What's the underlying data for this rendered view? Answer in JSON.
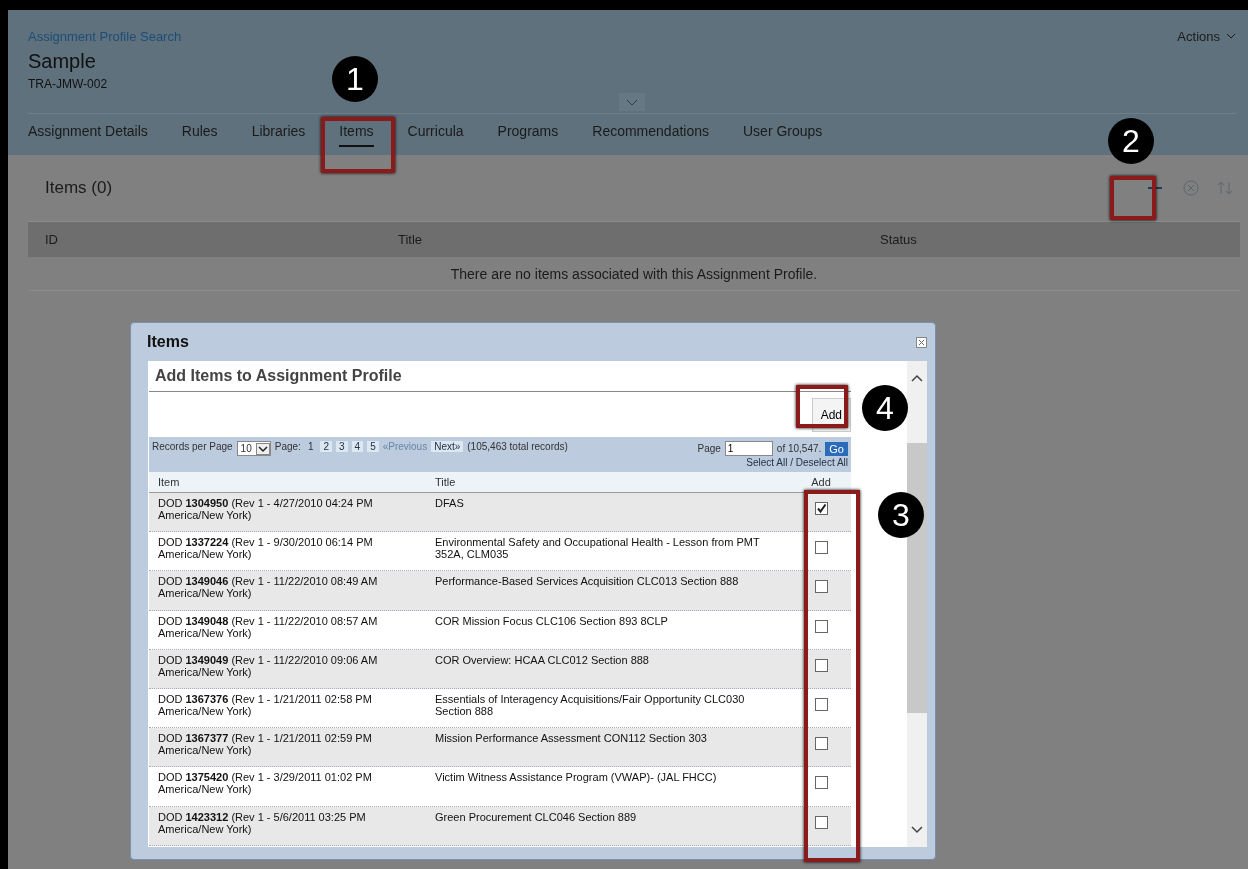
{
  "header": {
    "breadcrumb": "Assignment Profile Search",
    "title": "Sample",
    "code": "TRA-JMW-002",
    "actions": "Actions"
  },
  "tabs": [
    {
      "label": "Assignment Details",
      "selected": false
    },
    {
      "label": "Rules",
      "selected": false
    },
    {
      "label": "Libraries",
      "selected": false
    },
    {
      "label": "Items",
      "selected": true
    },
    {
      "label": "Curricula",
      "selected": false
    },
    {
      "label": "Programs",
      "selected": false
    },
    {
      "label": "Recommendations",
      "selected": false
    },
    {
      "label": "User Groups",
      "selected": false
    }
  ],
  "section": {
    "title": "Items (0)",
    "columns": [
      "ID",
      "Title",
      "Status"
    ],
    "empty_message": "There are no items associated with this Assignment Profile."
  },
  "dialog": {
    "title": "Items",
    "heading": "Add Items to Assignment Profile",
    "add_button": {
      "label": "Add"
    },
    "pager": {
      "records_label": "Records per Page",
      "per_page": "10",
      "page_label": "Page:",
      "pages": [
        {
          "label": "1",
          "selected": true
        },
        {
          "label": "2",
          "selected": false
        },
        {
          "label": "3",
          "selected": false
        },
        {
          "label": "4",
          "selected": false
        },
        {
          "label": "5",
          "selected": false
        }
      ],
      "previous": "«Previous",
      "next": "Next»",
      "total": "(105,463 total records)",
      "goto_label": "Page",
      "goto_value": "1",
      "of": "of 10,547.",
      "go": "Go",
      "select_all": "Select All / Deselect All"
    },
    "columns": [
      "Item",
      "Title",
      "Add"
    ],
    "rows": [
      {
        "item": "DOD **1304950** (Rev 1 - 4/27/2010 04:24 PM America/New York)",
        "title": "DFAS",
        "checked": true
      },
      {
        "item": "DOD **1337224** (Rev 1 - 9/30/2010 06:14 PM America/New York)",
        "title": "Environmental Safety and Occupational Health - Lesson from PMT 352A, CLM035",
        "checked": false
      },
      {
        "item": "DOD **1349046** (Rev 1 - 11/22/2010 08:49 AM America/New York)",
        "title": "Performance-Based Services Acquisition CLC013 Section 888",
        "checked": false
      },
      {
        "item": "DOD **1349048** (Rev 1 - 11/22/2010 08:57 AM America/New York)",
        "title": "COR Mission Focus CLC106 Section 893 8CLP",
        "checked": false
      },
      {
        "item": "DOD **1349049** (Rev 1 - 11/22/2010 09:06 AM America/New York)",
        "title": "COR Overview: HCAA CLC012 Section 888",
        "checked": false
      },
      {
        "item": "DOD **1367376** (Rev 1 - 1/21/2011 02:58 PM America/New York)",
        "title": "Essentials of Interagency Acquisitions/Fair Opportunity CLC030 Section 888",
        "checked": false
      },
      {
        "item": "DOD **1367377** (Rev 1 - 1/21/2011 02:59 PM America/New York)",
        "title": "Mission Performance Assessment CON112 Section 303",
        "checked": false
      },
      {
        "item": "DOD **1375420** (Rev 1 - 3/29/2011 01:02 PM America/New York)",
        "title": "Victim Witness Assistance Program (VWAP)- (JAL FHCC)",
        "checked": false
      },
      {
        "item": "DOD **1423312** (Rev 1 - 5/6/2011 03:25 PM America/New York)",
        "title": "Green Procurement CLC046 Section 889",
        "checked": false
      }
    ]
  },
  "callouts": [
    "1",
    "2",
    "3",
    "4"
  ]
}
